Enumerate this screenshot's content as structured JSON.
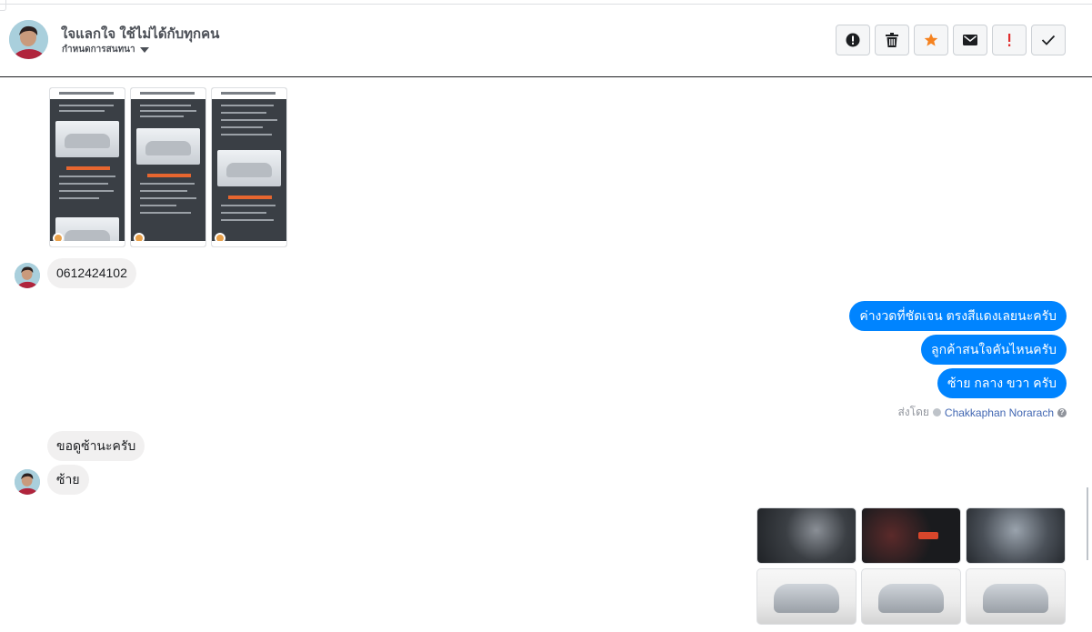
{
  "header": {
    "contact_name": "ใจแลกใจ ใช้ไม่ได้กับทุกคน",
    "assign_label": "กำหนดการสนทนา",
    "actions": [
      {
        "name": "mark-spam-button",
        "icon": "alert-circle-icon"
      },
      {
        "name": "delete-button",
        "icon": "trash-icon"
      },
      {
        "name": "star-button",
        "icon": "star-icon",
        "color": "#f5821f"
      },
      {
        "name": "mark-unread-button",
        "icon": "envelope-icon"
      },
      {
        "name": "follow-up-button",
        "icon": "exclamation-icon",
        "color": "#e02d2d"
      },
      {
        "name": "mark-done-button",
        "icon": "check-icon"
      }
    ]
  },
  "messages": {
    "incoming_1": "0612424102",
    "outgoing_1": "ค่างวดที่ชัดเจน ตรงสีแดงเลยนะครับ",
    "outgoing_2": "ลูกค้าสนใจคันไหนครับ",
    "outgoing_3": "ซ้าย กลาง ขวา ครับ",
    "sent_by_label": "ส่งโดย",
    "sent_by_agent": "Chakkaphan Norarach",
    "incoming_2": "ขอดูซ้านะครับ",
    "incoming_3": "ซ้าย"
  },
  "colors": {
    "outgoing_bubble": "#0084ff",
    "incoming_bubble": "#f1f0f0",
    "agent_link": "#4267b2"
  }
}
